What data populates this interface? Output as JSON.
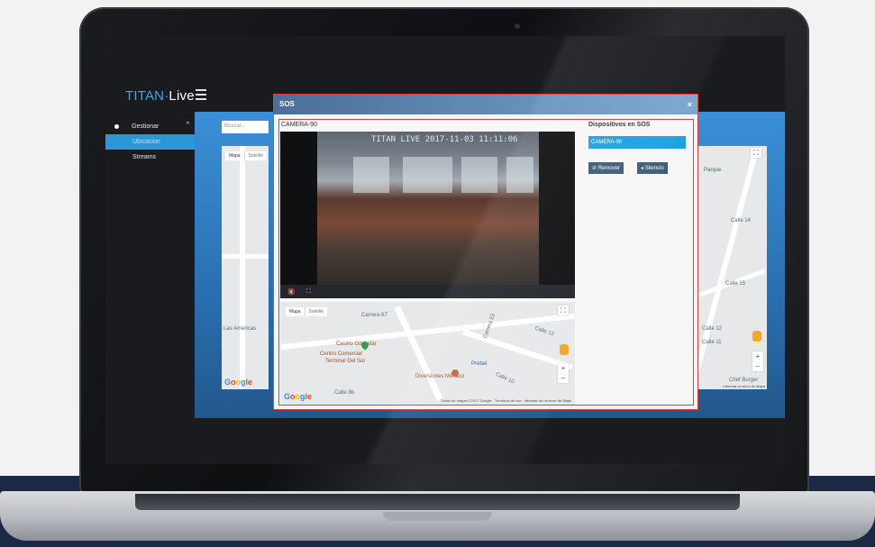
{
  "app": {
    "brand_part1": "TITAN",
    "brand_sep": "·",
    "brand_part2": "Live"
  },
  "sidebar": {
    "items": [
      {
        "label": "Gestionar"
      },
      {
        "label": "Ubicacion"
      },
      {
        "label": "Streams"
      }
    ]
  },
  "search": {
    "placeholder": "Buscar..."
  },
  "bg_map": {
    "tabs": [
      "Mapa",
      "Satélite"
    ],
    "left_label": "Las Americas",
    "right_labels": [
      "Parque",
      "Calle 14",
      "Calle 15",
      "Calle 12",
      "Calle 11",
      "Chef Burger"
    ],
    "right_footer": "Informar un error de Mapa"
  },
  "modal": {
    "title": "SOS",
    "close": "×",
    "camera_name": "CAMERA-90",
    "video_timestamp": "TITAN LIVE 2017-11-03 11:11:06",
    "devices_title": "Dispositivos en SOS",
    "device_chip": "CAMERA-90",
    "btn_remove": "Remover",
    "btn_silence": "Silencio"
  },
  "modal_map": {
    "tabs": [
      "Mapa",
      "Satélite"
    ],
    "labels": [
      "Carrera 67",
      "Casino Gold star",
      "Centro Comercial",
      "Terminal Del Sur",
      "Diversiones Mónaco",
      "Prebel",
      "Calle 10",
      "Calle 12",
      "Carrera 53",
      "Calle 8b"
    ],
    "footer_data": "Datos de mapas ©2017 Google",
    "footer_terms": "Términos de uso",
    "footer_report": "Informar de un error de Maps"
  },
  "colors": {
    "accent": "#2b97d8",
    "modal_border": "#e53935",
    "device_chip": "#1da1e2",
    "navy": "#1c2945"
  },
  "icons": [
    "menu-icon",
    "close-icon",
    "mute-icon",
    "fullscreen-icon",
    "remove-icon",
    "speaker-icon",
    "map-pin-icon",
    "pegman-icon"
  ]
}
